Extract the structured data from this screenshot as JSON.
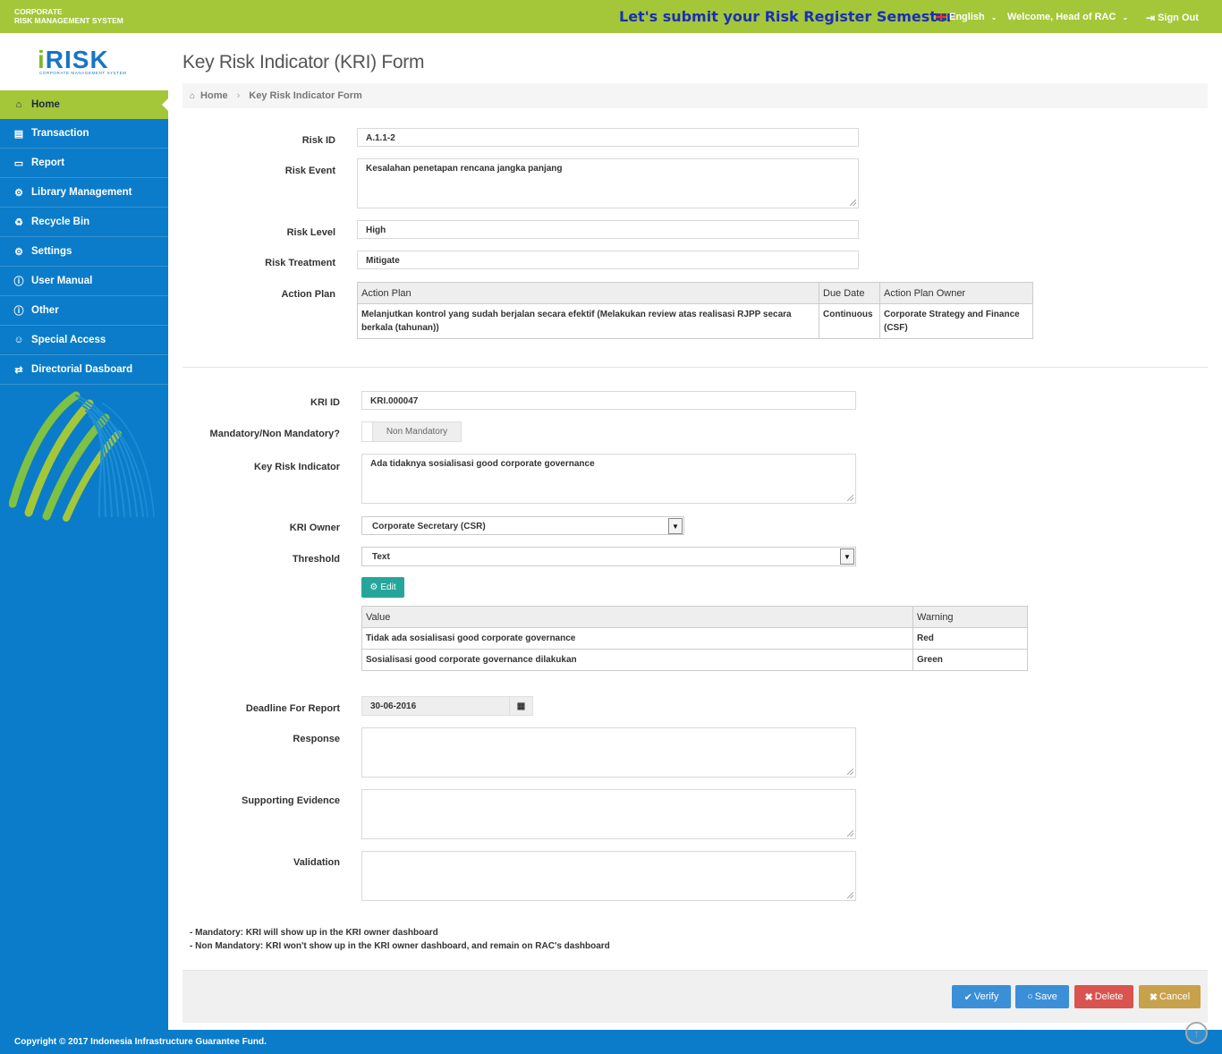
{
  "topbar": {
    "brand_line1": "CORPORATE",
    "brand_line2": "RISK MANAGEMENT SYSTEM",
    "announcement": "Let's submit your Risk Register Semester",
    "language": "English",
    "welcome": "Welcome, Head of RAC",
    "signout": "Sign Out"
  },
  "logo": {
    "text_i": "i",
    "text_rest": "RISK",
    "subtitle": "CORPORATE MANAGEMENT SYSTEM"
  },
  "sidebar": {
    "items": [
      {
        "label": "Home",
        "icon": "home-icon"
      },
      {
        "label": "Transaction",
        "icon": "book-icon"
      },
      {
        "label": "Report",
        "icon": "folder-icon"
      },
      {
        "label": "Library Management",
        "icon": "gear-icon"
      },
      {
        "label": "Recycle Bin",
        "icon": "recycle-icon"
      },
      {
        "label": "Settings",
        "icon": "gear-icon"
      },
      {
        "label": "User Manual",
        "icon": "info-icon"
      },
      {
        "label": "Other",
        "icon": "info-icon"
      },
      {
        "label": "Special Access",
        "icon": "user-icon"
      },
      {
        "label": "Directorial Dasboard",
        "icon": "arrows-icon"
      }
    ]
  },
  "page": {
    "title": "Key Risk Indicator (KRI) Form",
    "breadcrumb_home": "Home",
    "breadcrumb_current": "Key Risk Indicator Form"
  },
  "risk": {
    "id_label": "Risk ID",
    "id_value": "A.1.1-2",
    "event_label": "Risk Event",
    "event_value": "Kesalahan penetapan rencana jangka panjang",
    "level_label": "Risk Level",
    "level_value": "High",
    "treatment_label": "Risk Treatment",
    "treatment_value": "Mitigate",
    "action_plan_label": "Action Plan",
    "action_plan_headers": [
      "Action Plan",
      "Due Date",
      "Action Plan Owner"
    ],
    "action_plan_row": [
      "Melanjutkan kontrol yang sudah berjalan secara efektif (Melakukan review atas realisasi RJPP secara berkala (tahunan))",
      "Continuous",
      "Corporate Strategy and Finance (CSF)"
    ]
  },
  "kri": {
    "id_label": "KRI ID",
    "id_value": "KRI.000047",
    "mandatory_label": "Mandatory/Non Mandatory?",
    "mandatory_value": "Non Mandatory",
    "indicator_label": "Key Risk Indicator",
    "indicator_value": "Ada tidaknya sosialisasi good corporate governance",
    "owner_label": "KRI Owner",
    "owner_value": "Corporate Secretary (CSR)",
    "threshold_label": "Threshold",
    "threshold_value": "Text",
    "edit_label": "Edit",
    "threshold_headers": [
      "Value",
      "Warning"
    ],
    "threshold_rows": [
      [
        "Tidak ada sosialisasi good corporate governance",
        "Red"
      ],
      [
        "Sosialisasi good corporate governance dilakukan",
        "Green"
      ]
    ],
    "deadline_label": "Deadline For Report",
    "deadline_value": "30-06-2016",
    "response_label": "Response",
    "evidence_label": "Supporting Evidence",
    "validation_label": "Validation"
  },
  "notes": {
    "line1": "- Mandatory: KRI will show up in the KRI owner dashboard",
    "line2": "- Non Mandatory: KRI won't show up in the KRI owner dashboard, and remain on RAC's dashboard"
  },
  "actions": {
    "verify": "Verify",
    "save": "Save",
    "delete": "Delete",
    "cancel": "Cancel"
  },
  "footer": {
    "copyright": "Copyright © 2017 Indonesia Infrastructure Guarantee Fund."
  },
  "colors": {
    "topbar": "#a4c739",
    "sidebar": "#0b7cc9",
    "accent_blue": "#3a8fd8",
    "danger": "#d9534f",
    "warning": "#c8a14b",
    "teal": "#26a69a"
  }
}
